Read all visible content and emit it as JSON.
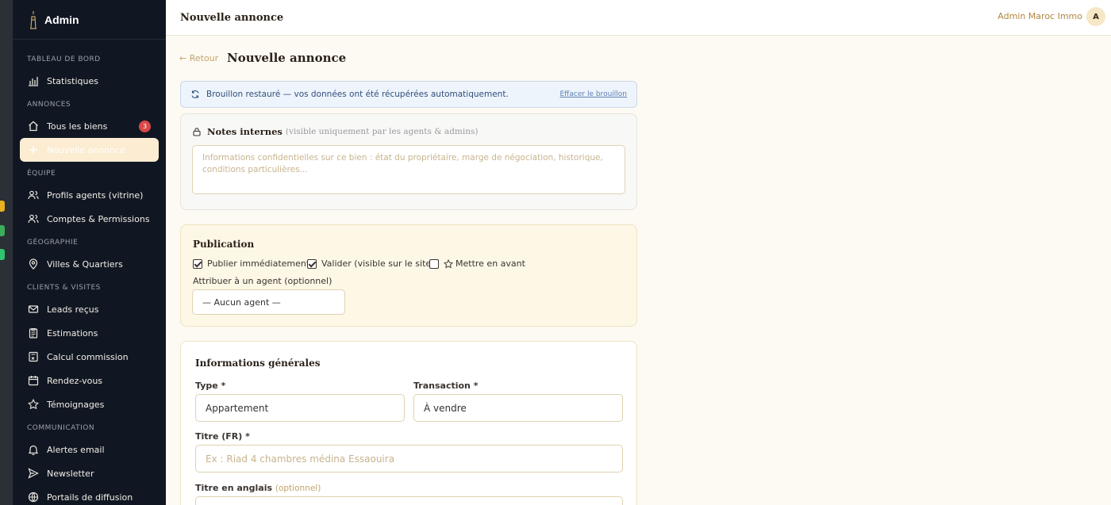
{
  "sidebar": {
    "brand": "Admin",
    "sections": {
      "dashboard": "TABLEAU DE BORD",
      "listings": "ANNONCES",
      "team": "ÉQUIPE",
      "geo": "GÉOGRAPHIE",
      "clients": "CLIENTS & VISITES",
      "comm": "COMMUNICATION"
    },
    "items": {
      "stats": "Statistiques",
      "all": "Tous les biens",
      "all_badge": "3",
      "new": "Nouvelle annonce",
      "agents": "Profils agents (vitrine)",
      "accounts": "Comptes & Permissions",
      "cities": "Villes & Quartiers",
      "leads": "Leads reçus",
      "estimates": "Estimations",
      "commission": "Calcul commission",
      "appointments": "Rendez-vous",
      "testimonials": "Témoignages",
      "alerts": "Alertes email",
      "newsletter": "Newsletter",
      "portals": "Portails de diffusion"
    }
  },
  "topbar": {
    "title": "Nouvelle annonce",
    "user": "Admin Maroc Immo",
    "avatar": "A"
  },
  "page": {
    "back": "← Retour",
    "title": "Nouvelle annonce"
  },
  "draft": {
    "message": "Brouillon restauré — vos données ont été récupérées automatiquement.",
    "clear": "Effacer le brouillon"
  },
  "notes": {
    "title": "Notes internes",
    "subtitle": "(visible uniquement par les agents & admins)",
    "placeholder": "Informations confidentielles sur ce bien : état du propriétaire, marge de négociation, historique, conditions particulières..."
  },
  "publication": {
    "title": "Publication",
    "publish_now": "Publier immédiatement",
    "publish_now_checked": true,
    "validate": "Valider (visible sur le site)",
    "validate_checked": true,
    "featured": "Mettre en avant",
    "featured_checked": false,
    "agent_label": "Attribuer à un agent (optionnel)",
    "agent_value": "— Aucun agent —"
  },
  "info": {
    "title": "Informations générales",
    "type_label": "Type *",
    "type_value": "Appartement",
    "transaction_label": "Transaction *",
    "transaction_value": "À vendre",
    "title_fr_label": "Titre (FR) *",
    "title_fr_placeholder": "Ex : Riad 4 chambres médina Essaouira",
    "title_en_label": "Titre en anglais",
    "title_en_optional": "(optionnel)"
  },
  "colors": {
    "sidebar_bg": "#111722",
    "accent": "#c4a36a",
    "active_bg": "#fbecd2",
    "badge": "#d94848"
  }
}
